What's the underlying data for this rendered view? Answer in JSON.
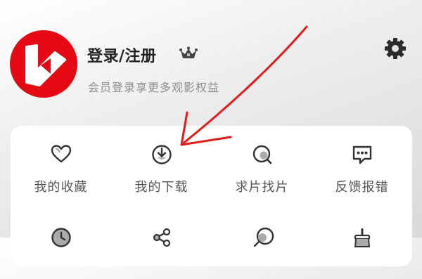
{
  "profile": {
    "login_label": "登录/注册",
    "subtitle": "会员登录享更多观影权益"
  },
  "menu": {
    "items": [
      {
        "label": "我的收藏",
        "icon": "heart-icon"
      },
      {
        "label": "我的下载",
        "icon": "download-icon"
      },
      {
        "label": "求片找片",
        "icon": "search-film-icon"
      },
      {
        "label": "反馈报错",
        "icon": "feedback-icon"
      }
    ]
  },
  "colors": {
    "brand": "#e50914",
    "annotation": "#e31b1b",
    "text_dark": "#222222",
    "text_muted": "#8c8c8c"
  }
}
